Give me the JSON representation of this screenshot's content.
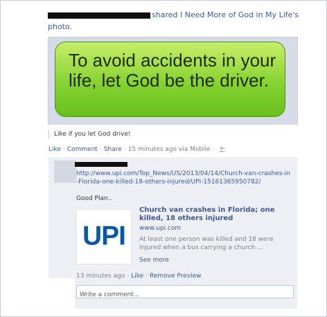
{
  "post": {
    "header_suffix": "shared I Need More of God in My Life's",
    "header_line2": "photo.",
    "photo_text": "To avoid accidents in your life, let God be the driver.",
    "caption": "Like if you let God drive!",
    "actions": {
      "like": "Like",
      "comment": "Comment",
      "share": "Share",
      "time": "15 minutes ago via Mobile"
    }
  },
  "comment": {
    "url": "http://www.upi.com/Top_News/US/2013/04/14/Church-van-crashes-in-Florida-one-killed-18-others-injured/UPI-15161365950782/",
    "text": "Good Plan..",
    "share": {
      "logo_text": "UPI",
      "title": "Church van crashes in Florida; one killed, 18 others injured",
      "domain": "www.upi.com",
      "description": "At least one person was killed and 18 were injured when a bus carrying a church ...",
      "see_more": "See more"
    },
    "meta": {
      "time": "13 minutes ago",
      "like": "Like",
      "remove_preview": "Remove Preview"
    }
  },
  "composer": {
    "placeholder": "Write a comment..."
  },
  "colors": {
    "link": "#3b5998",
    "bubble_green": "#86d331",
    "upi_blue": "#0a5aa3"
  },
  "icons": [
    "friends-icon"
  ]
}
